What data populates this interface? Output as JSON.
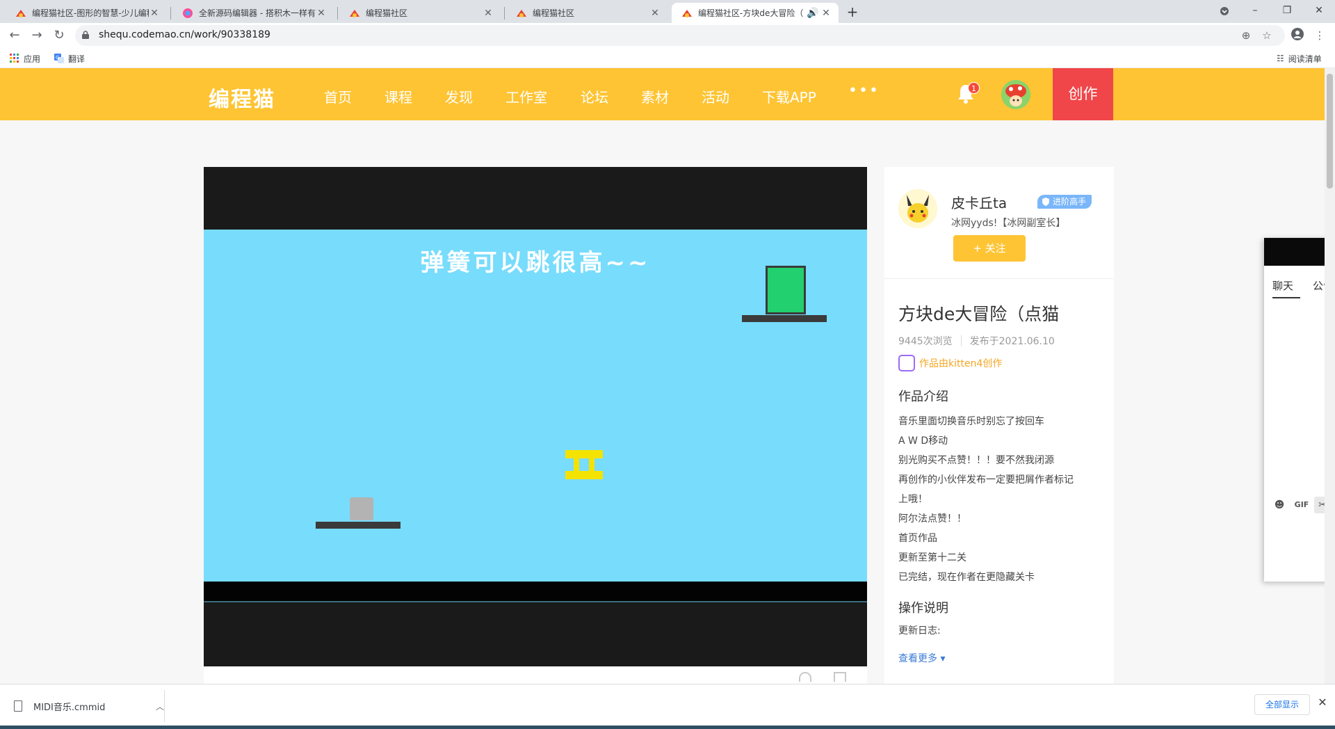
{
  "browser": {
    "tabs": [
      {
        "title": "编程猫社区-图形的智慧-少儿编程",
        "active": false
      },
      {
        "title": "全新源码编辑器 - 搭积木一样有趣",
        "active": false
      },
      {
        "title": "编程猫社区",
        "active": false
      },
      {
        "title": "编程猫社区",
        "active": false
      },
      {
        "title": "编程猫社区-方块de大冒险（",
        "active": true
      }
    ],
    "new_tab": "+",
    "url": "shequ.codemao.cn/work/90338189",
    "bookmarks": [
      "应用",
      "翻译"
    ],
    "reading_list": "阅读清单"
  },
  "site": {
    "logo": "编程猫",
    "nav": [
      "首页",
      "课程",
      "发现",
      "工作室",
      "论坛",
      "素材",
      "活动",
      "下载APP"
    ],
    "more": "•••",
    "notification_count": "1",
    "create_button": "创作"
  },
  "game": {
    "stage_title": "弹簧可以跳很高~~"
  },
  "author": {
    "name": "皮卡丘ta",
    "badge": "进阶高手",
    "motto": "冰网yyds!【冰网副室长】",
    "follow": "+ 关注"
  },
  "work": {
    "title": "方块de大冒险（点猫",
    "views": "9445次浏览",
    "published": "发布于2021.06.10",
    "made_by": "作品由kitten4创作",
    "intro_heading": "作品介绍",
    "intro_lines": [
      "音乐里面切换音乐时别忘了按回车",
      "A   W   D移动",
      "别光购买不点赞！！！要不然我闭源",
      "再创作的小伙伴发布一定要把屑作者标记",
      "上哦！",
      "阿尔法点赞！！",
      "首页作品",
      "更新至第十二关",
      "已完结，现在作者在更隐藏关卡"
    ],
    "ops_heading": "操作说明",
    "ops_text": "更新日志:",
    "see_more": "查看更多 ▾"
  },
  "chat": {
    "tabs": [
      "聊天",
      "公告"
    ]
  },
  "downloads": {
    "file": "MIDI音乐.cmmid",
    "show_all": "全部显示"
  },
  "colors": {
    "header": "#fec433",
    "create": "#f0464a",
    "stage": "#78dcfc",
    "block_green": "#22d06f",
    "spring": "#f4e300"
  }
}
